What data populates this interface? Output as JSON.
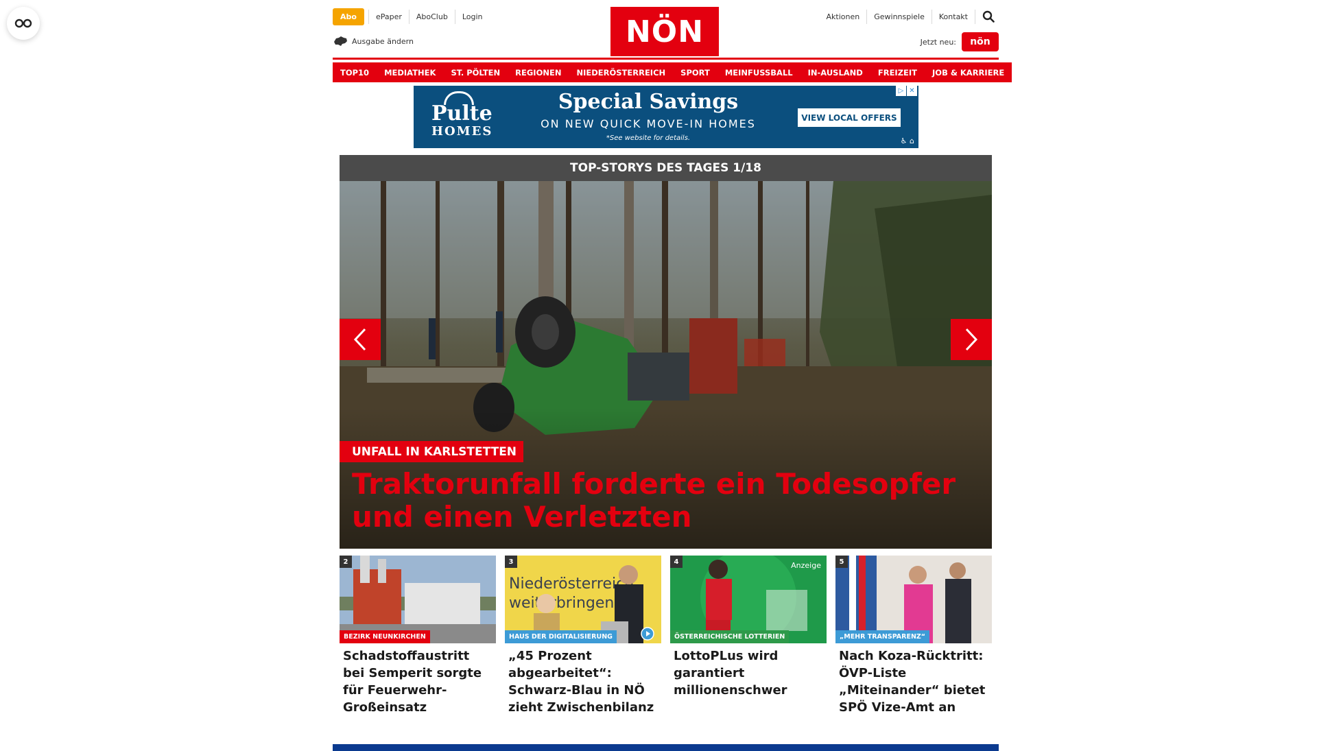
{
  "header": {
    "abo_label": "Abo",
    "left_links": [
      "ePaper",
      "AboClub",
      "Login"
    ],
    "edition_label": "Ausgabe ändern",
    "logo_text": "NÖN",
    "right_links": [
      "Aktionen",
      "Gewinnspiele",
      "Kontakt"
    ],
    "jetzt_label": "Jetzt neu:",
    "jetzt_badge": "nön"
  },
  "nav": [
    "TOP10",
    "MEDIATHEK",
    "ST. PÖLTEN",
    "REGIONEN",
    "NIEDERÖSTERREICH",
    "SPORT",
    "MEINFUSSBALL",
    "IN-AUSLAND",
    "FREIZEIT",
    "JOB & KARRIERE"
  ],
  "ad": {
    "brand_top": "Pulte",
    "brand_bottom": "HOMES",
    "headline": "Special Savings",
    "subline": "ON NEW QUICK MOVE-IN HOMES",
    "small": "*See website for details.",
    "cta": "VIEW LOCAL OFFERS"
  },
  "slider": {
    "heading": "TOP-STORYS DES TAGES 1/18",
    "kicker": "UNFALL IN KARLSTETTEN",
    "title": "Traktorunfall forderte ein Todesopfer und einen Verletzten"
  },
  "cards": [
    {
      "num": "2",
      "kicker": "BEZIRK NEUNKIRCHEN",
      "title": "Schadstoffaustritt bei Semperit sorgte für Feuerwehr-Großeinsatz"
    },
    {
      "num": "3",
      "kicker": "HAUS DER DIGITALISIERUNG",
      "title": "„45 Prozent abgearbeitet“: Schwarz-Blau in NÖ zieht Zwischenbilanz",
      "image_text": "Niederösterreich weiterbringen"
    },
    {
      "num": "4",
      "kicker": "ÖSTERREICHISCHE LOTTERIEN",
      "anzeige": "Anzeige",
      "title": "LottoPLus wird garantiert millionenschwer"
    },
    {
      "num": "5",
      "kicker": "„MEHR TRANSPARENZ“",
      "title": "Nach Koza-Rücktritt: ÖVP-Liste „Miteinander“ bietet SPÖ Vize-Amt an"
    }
  ],
  "colors": {
    "brand_red": "#e3000f",
    "abo_orange": "#f5a400",
    "ad_blue": "#0b4f7e",
    "slider_head": "#4b4b4b",
    "kicker_blue": "#3d9bd6"
  }
}
